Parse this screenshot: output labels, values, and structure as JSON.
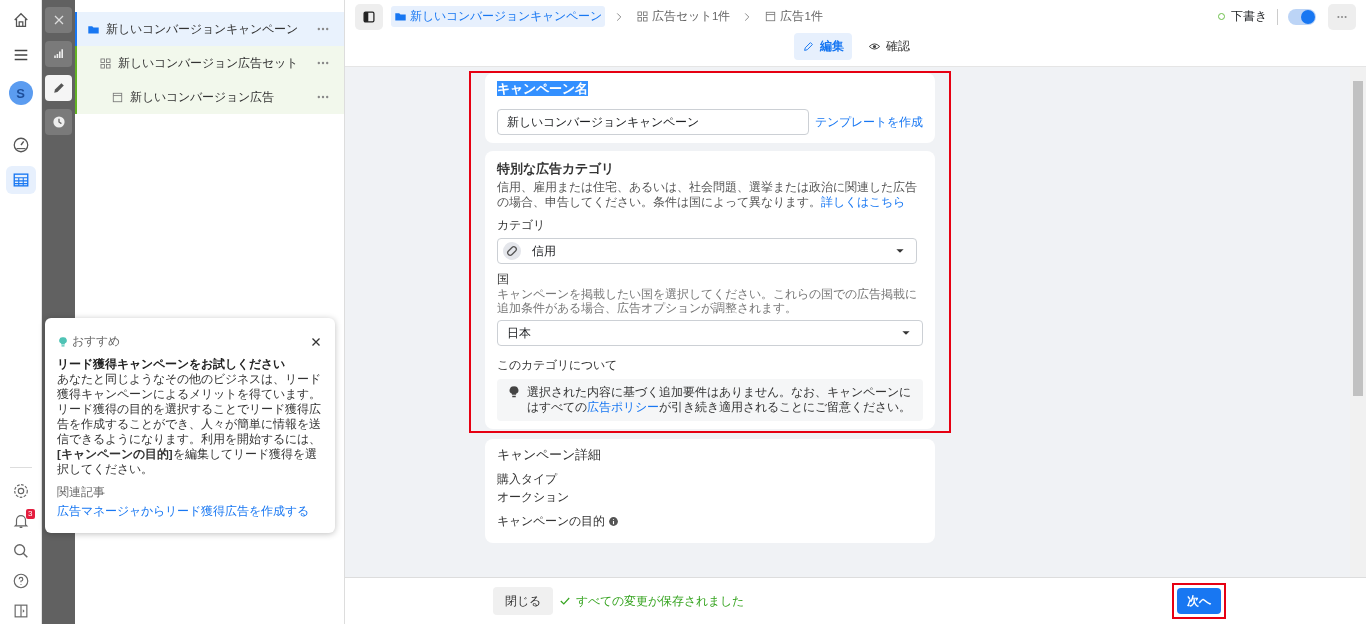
{
  "rail": {
    "items": [
      {
        "kind": "home",
        "selected": false
      },
      {
        "kind": "menu",
        "selected": false
      },
      {
        "kind": "avatar",
        "label": "S",
        "selected": false
      },
      {
        "kind": "gauge",
        "selected": false
      },
      {
        "kind": "table",
        "selected": true
      }
    ],
    "bottom_items": [
      {
        "kind": "settings"
      },
      {
        "kind": "bell",
        "badge": "3"
      },
      {
        "kind": "search"
      },
      {
        "kind": "help"
      },
      {
        "kind": "panel"
      }
    ]
  },
  "tool_strip": [
    {
      "kind": "close",
      "selected": false
    },
    {
      "kind": "chart",
      "selected": false
    },
    {
      "kind": "edit",
      "selected": true
    },
    {
      "kind": "history",
      "selected": false
    }
  ],
  "tree": [
    {
      "kind": "campaign",
      "label": "新しいコンバージョンキャンペーン",
      "selected": true,
      "children": [
        {
          "kind": "adset",
          "label": "新しいコンバージョン広告セット",
          "selected": false,
          "children": [
            {
              "kind": "ad",
              "label": "新しいコンバージョン広告",
              "selected": false
            }
          ]
        }
      ]
    }
  ],
  "breadcrumbs": [
    {
      "kind": "campaign",
      "label": "新しいコンバージョンキャンペーン",
      "selected": true
    },
    {
      "kind": "adset",
      "label": "広告セット1件",
      "selected": false
    },
    {
      "kind": "ad",
      "label": "広告1件",
      "selected": false
    }
  ],
  "status": {
    "label": "下書き",
    "on": true
  },
  "view_tabs": [
    {
      "kind": "edit",
      "label": "編集",
      "selected": true
    },
    {
      "kind": "view",
      "label": "確認",
      "selected": false
    }
  ],
  "campaign_name": {
    "heading": "キャンペーン名",
    "value": "新しいコンバージョンキャンペーン",
    "link": "テンプレートを作成"
  },
  "special_category": {
    "heading": "特別な広告カテゴリ",
    "description": "信用、雇用または住宅、あるいは、社会問題、選挙または政治に関連した広告の場合、申告してください。条件は国によって異なります。",
    "learn_more": "詳しくはこちら",
    "category_label": "カテゴリ",
    "category_value": "信用",
    "country_label": "国",
    "country_help": "キャンペーンを掲載したい国を選択してください。これらの国での広告掲載に追加条件がある場合、広告オプションが調整されます。",
    "country_value": "日本",
    "about_heading": "このカテゴリについて",
    "about_text": "選択された内容に基づく追加要件はありません。なお、キャンペーンにはすべての",
    "policy_link": "広告ポリシー",
    "about_text_end": "が引き続き適用されることにご留意ください。"
  },
  "campaign_details": {
    "heading": "キャンペーン詳細",
    "fields": [
      {
        "label": "購入タイプ",
        "value": "オークション",
        "info": false
      },
      {
        "label": "キャンペーンの目的",
        "info": true
      }
    ]
  },
  "footer": {
    "close_button": "閉じる",
    "save_status": "すべての変更が保存されました",
    "next_button": "次へ"
  },
  "tip": {
    "tag": "おすすめ",
    "title": "リード獲得キャンペーンをお試しください",
    "body": "あなたと同じようなその他のビジネスは、リード獲得キャンペーンによるメリットを得ています。リード獲得の目的を選択することでリード獲得広告を作成することができ、人々が簡単に情報を送信できるようになります。利用を開始するには、**[キャンペーンの目的]**を編集してリード獲得を選択してください。",
    "related_heading": "関連記事",
    "link": "広告マネージャからリード獲得広告を作成する"
  }
}
